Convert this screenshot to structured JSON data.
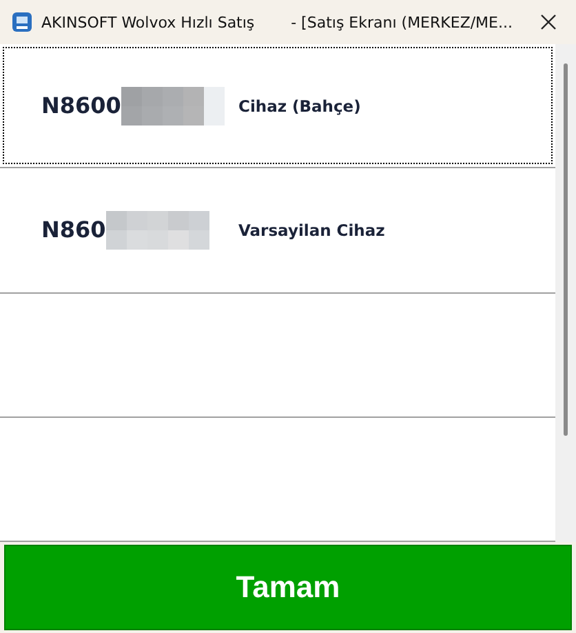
{
  "window": {
    "title": "AKINSOFT Wolvox Hızlı Satış",
    "subtitle": "- [Satış Ekranı (MERKEZ/ME..."
  },
  "rows": [
    {
      "kind": "device",
      "code": "N8600",
      "name": "Cihaz (Bahçe)",
      "selected": true
    },
    {
      "kind": "device",
      "code": "N860",
      "name": "Varsayilan Cihaz",
      "selected": false
    },
    {
      "kind": "empty"
    },
    {
      "kind": "empty"
    }
  ],
  "confirm_button": "Tamam"
}
